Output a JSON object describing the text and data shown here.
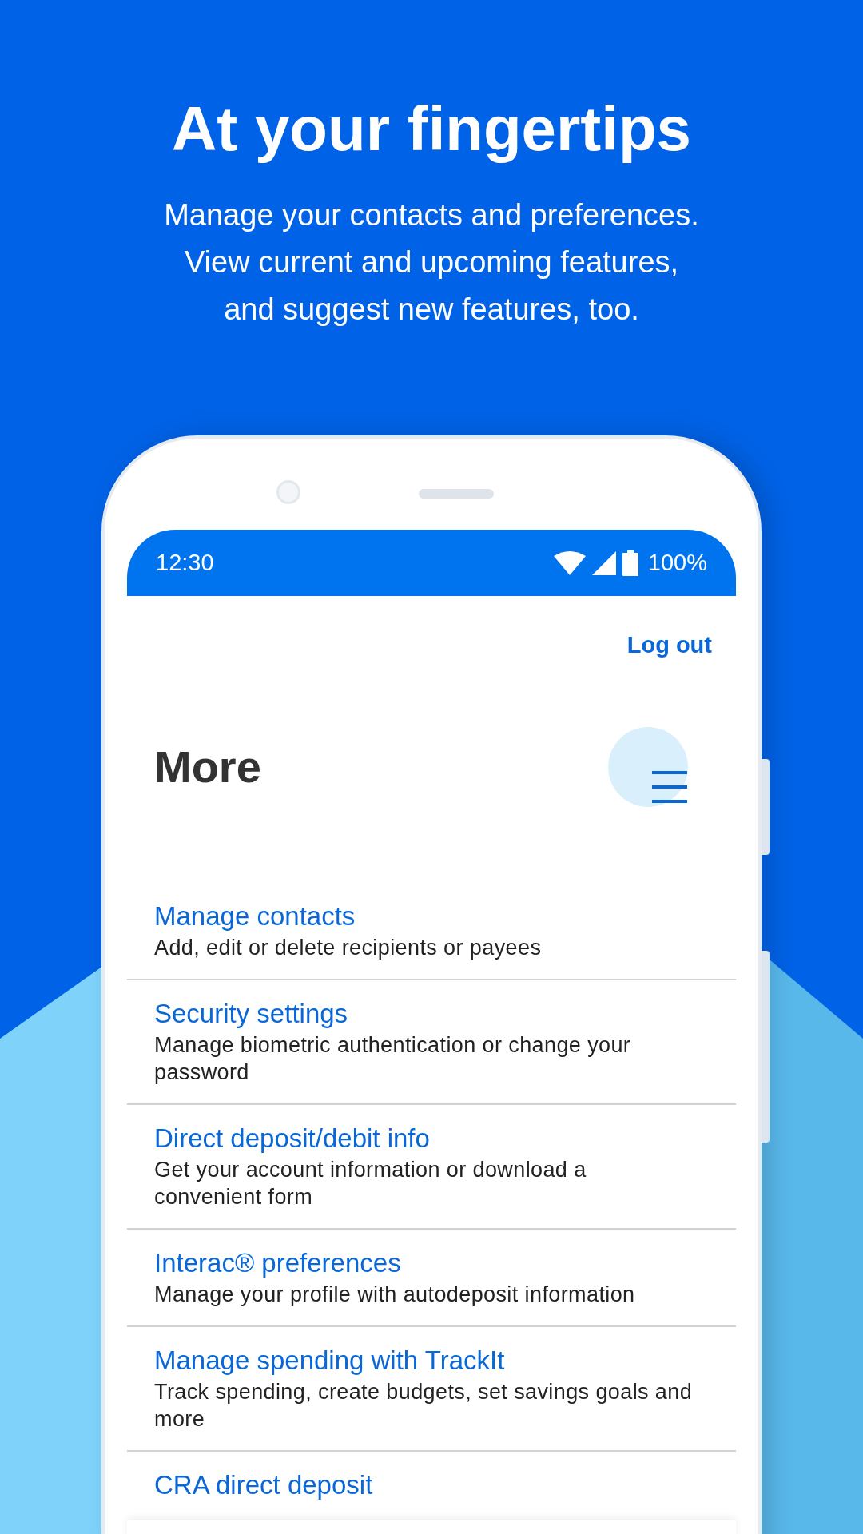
{
  "headline": "At your fingertips",
  "subtitle_lines": [
    "Manage your contacts and preferences.",
    "View current and upcoming features,",
    "and suggest new features, too."
  ],
  "status_bar": {
    "time": "12:30",
    "battery": "100%"
  },
  "logout": "Log out",
  "page_title": "More",
  "menu_items": [
    {
      "title": "Manage contacts",
      "description": "Add, edit or delete recipients or payees"
    },
    {
      "title": "Security settings",
      "description": "Manage biometric authentication or change your password"
    },
    {
      "title": "Direct deposit/debit info",
      "description": "Get your account information or download a convenient form"
    },
    {
      "title": "Interac® preferences",
      "description": "Manage your profile with autodeposit information"
    },
    {
      "title": "Manage spending with TrackIt",
      "description": "Track spending, create budgets, set savings goals and more"
    },
    {
      "title": "CRA direct deposit"
    }
  ]
}
